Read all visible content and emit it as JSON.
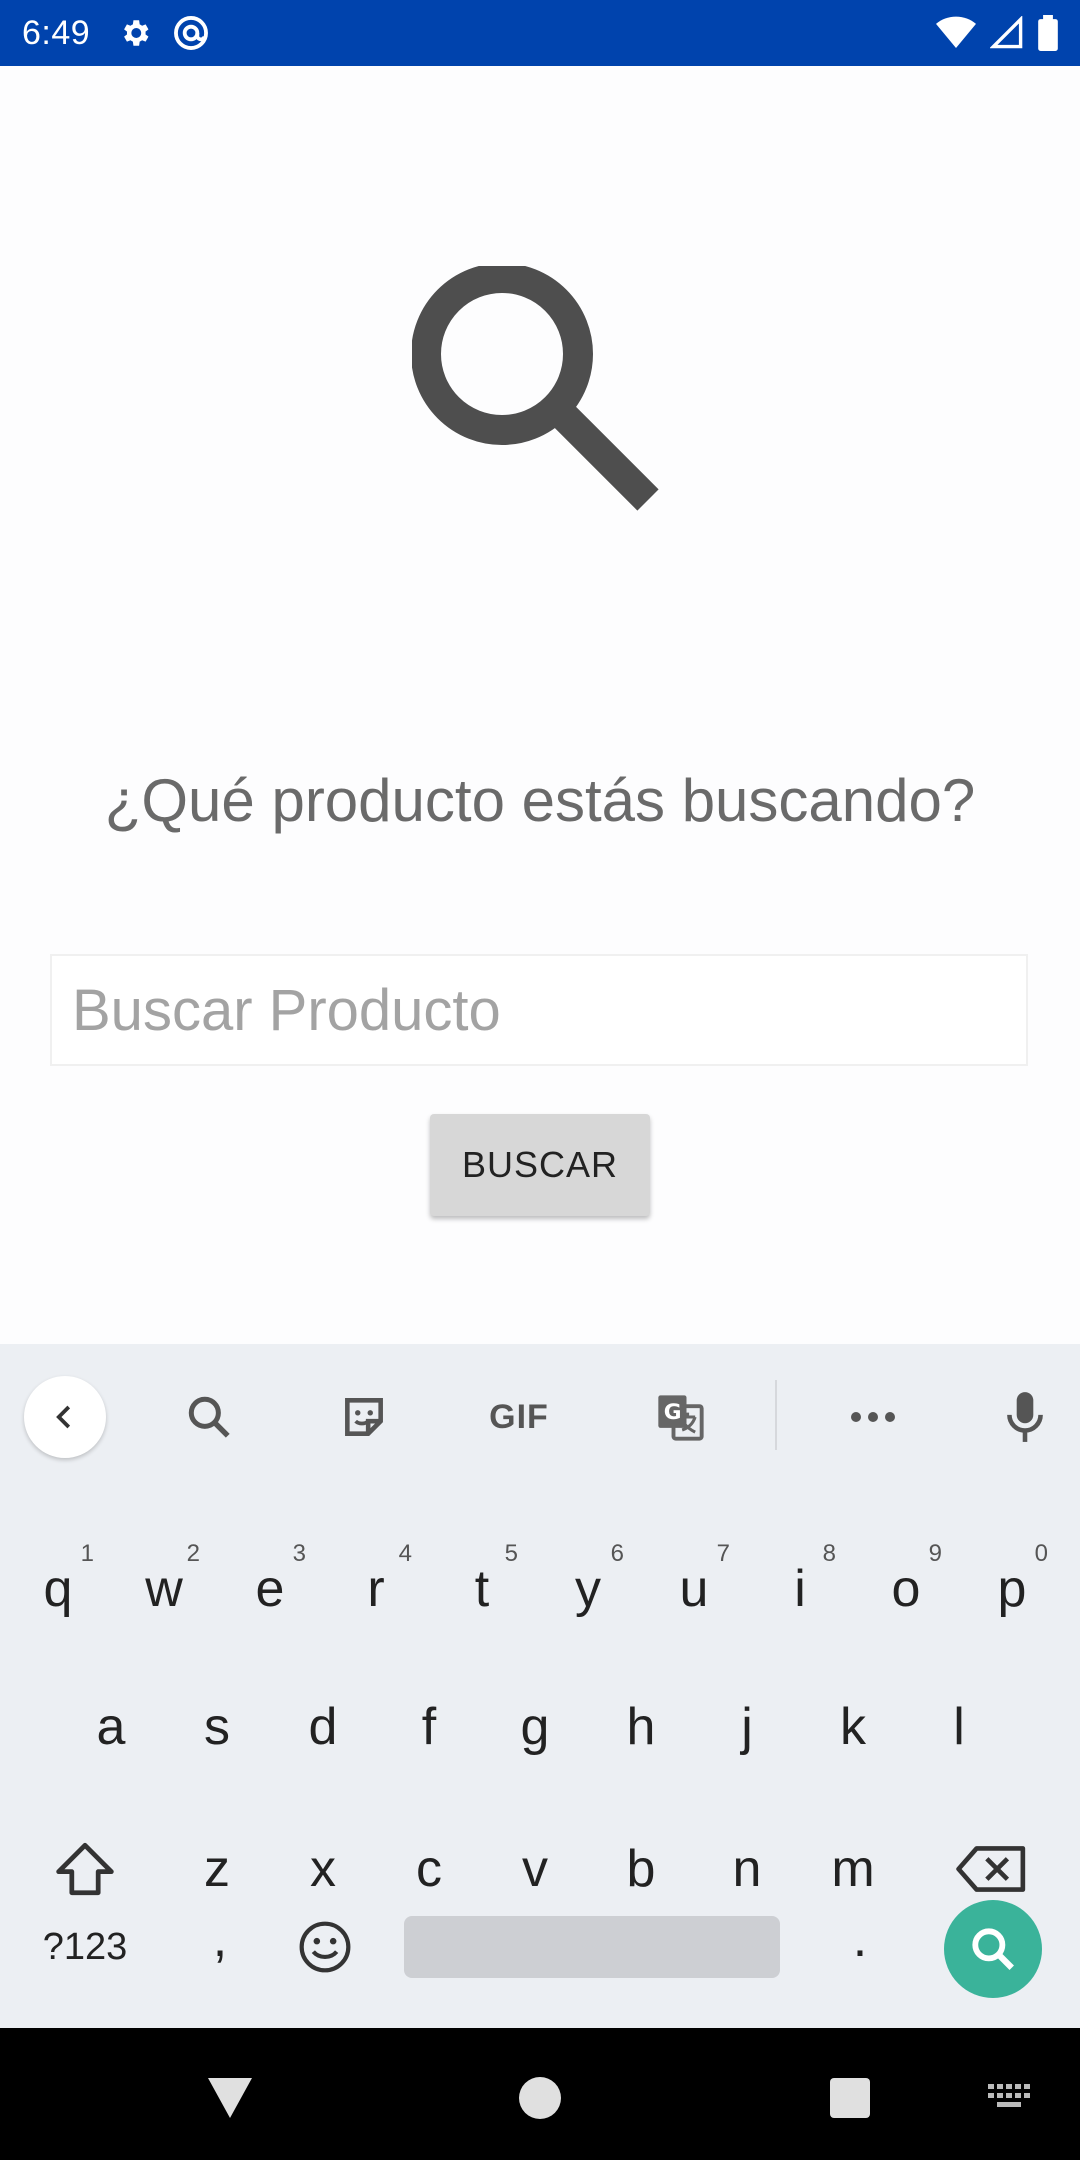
{
  "status_bar": {
    "time": "6:49",
    "left_icons": [
      "gear-icon",
      "at-sign-icon"
    ],
    "right_icons": [
      "wifi-icon",
      "signal-icon",
      "battery-icon"
    ],
    "background_color": "#0043ad"
  },
  "main": {
    "hero_icon": "search-icon",
    "prompt": "¿Qué producto estás buscando?",
    "search_input": {
      "value": "",
      "placeholder": "Buscar Producto"
    },
    "search_button_label": "BUSCAR"
  },
  "keyboard": {
    "toolbar": {
      "back_icon": "chevron-left-icon",
      "items": [
        "search-icon",
        "sticker-icon",
        "GIF",
        "translate-icon",
        "more-icon",
        "microphone-icon"
      ]
    },
    "row1": [
      {
        "key": "q",
        "hint": "1"
      },
      {
        "key": "w",
        "hint": "2"
      },
      {
        "key": "e",
        "hint": "3"
      },
      {
        "key": "r",
        "hint": "4"
      },
      {
        "key": "t",
        "hint": "5"
      },
      {
        "key": "y",
        "hint": "6"
      },
      {
        "key": "u",
        "hint": "7"
      },
      {
        "key": "i",
        "hint": "8"
      },
      {
        "key": "o",
        "hint": "9"
      },
      {
        "key": "p",
        "hint": "0"
      }
    ],
    "row2": [
      "a",
      "s",
      "d",
      "f",
      "g",
      "h",
      "j",
      "k",
      "l"
    ],
    "row3": [
      "z",
      "x",
      "c",
      "v",
      "b",
      "n",
      "m"
    ],
    "row4": {
      "symbols": "?123",
      "comma": ",",
      "period": "."
    },
    "enter_color": "#3ab39a"
  },
  "nav_bar": {
    "items": [
      "back-triangle-icon",
      "home-circle-icon",
      "recents-square-icon",
      "keyboard-switch-icon"
    ]
  }
}
